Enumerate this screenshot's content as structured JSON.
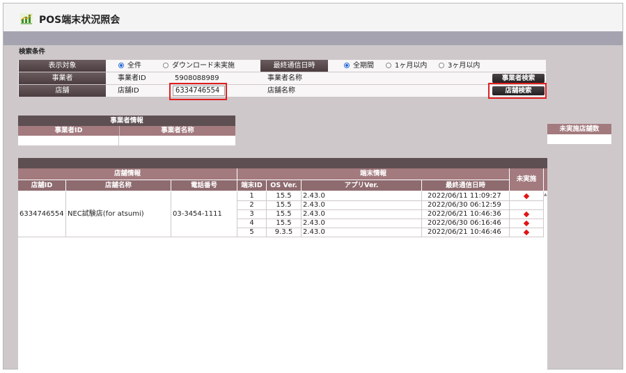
{
  "app": {
    "title": "POS端末状況照会"
  },
  "search": {
    "section_label": "検索条件",
    "target": {
      "label": "表示対象",
      "options": [
        "全件",
        "ダウンロード未実施"
      ],
      "selected": "全件"
    },
    "last_comm": {
      "label": "最終通信日時",
      "options": [
        "全期間",
        "1ヶ月以内",
        "3ヶ月以内"
      ],
      "selected": "全期間"
    },
    "operator": {
      "label": "事業者",
      "id_label": "事業者ID",
      "id_value": "5908088989",
      "name_label": "事業者名称",
      "search_button": "事業者検索"
    },
    "store": {
      "label": "店舗",
      "id_label": "店舗ID",
      "id_value": "6334746554",
      "name_label": "店舗名称",
      "search_button": "店舗検索"
    }
  },
  "operator_info": {
    "title": "事業者情報",
    "col_id": "事業者ID",
    "col_name": "事業者名称"
  },
  "unimplemented_panel": {
    "title": "未実施店舗数"
  },
  "main_table": {
    "store_group": "店舗情報",
    "terminal_group": "端末情報",
    "unimplemented_header": "未実施",
    "columns": {
      "store_id": "店舗ID",
      "store_name": "店舗名称",
      "phone": "電話番号",
      "terminal_id": "端末ID",
      "os_ver": "OS Ver.",
      "app_ver": "アプリVer.",
      "last_comm": "最終通信日時"
    },
    "store": {
      "id": "6334746554",
      "name": "NEC試験店(for atsumi)",
      "phone": "03-3454-1111"
    },
    "terminals": [
      {
        "id": "1",
        "os": "15.5",
        "app": "2.43.0",
        "last": "2022/06/11 11:09:27",
        "unimplemented": true
      },
      {
        "id": "2",
        "os": "15.5",
        "app": "2.43.0",
        "last": "2022/06/30 06:12:59",
        "unimplemented": false
      },
      {
        "id": "3",
        "os": "15.5",
        "app": "2.43.0",
        "last": "2022/06/21 10:46:36",
        "unimplemented": true
      },
      {
        "id": "4",
        "os": "15.5",
        "app": "2.43.0",
        "last": "2022/06/30 06:16:46",
        "unimplemented": true
      },
      {
        "id": "5",
        "os": "9.3.5",
        "app": "2.43.0",
        "last": "2022/06/21 10:46:46",
        "unimplemented": true
      }
    ]
  },
  "colors": {
    "header_dark": "#5d4f52",
    "header_rose": "#a37a7e",
    "highlight": "#e02020",
    "diamond": "#e01515",
    "radio_selected": "#2a6bd6"
  }
}
